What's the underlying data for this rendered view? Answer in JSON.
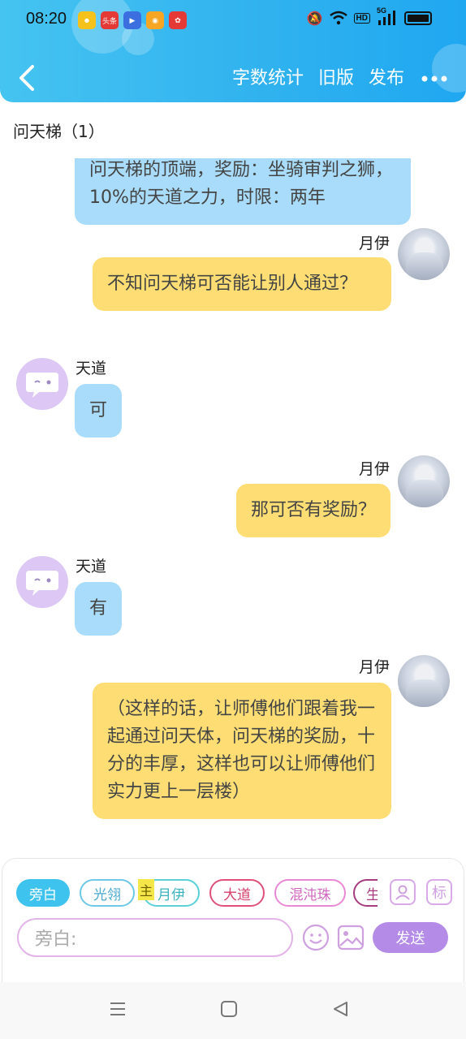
{
  "status_bar": {
    "time": "08:20",
    "notification_icons": [
      {
        "name": "app-icon-yellow",
        "color": "#f4c21a",
        "text": ""
      },
      {
        "name": "toutiao-icon",
        "color": "#e53935",
        "text": "头条"
      },
      {
        "name": "video-app-icon",
        "color": "#3b6fe0",
        "text": ""
      },
      {
        "name": "weibo-icon",
        "color": "#f6a623",
        "text": ""
      },
      {
        "name": "app-icon-red",
        "color": "#e53935",
        "text": ""
      }
    ],
    "signal_label": "5G",
    "hd_label": "HD"
  },
  "header": {
    "back_icon": "chevron-left-icon",
    "actions": [
      "字数统计",
      "旧版",
      "发布"
    ],
    "more_icon": "more-horizontal-icon",
    "accent": "#33b4ef"
  },
  "chat": {
    "title": "问天梯（1）",
    "messages": [
      {
        "side": "left",
        "sender": "",
        "text": "问天梯的顶端，奖励：坐骑审判之狮，10%的天道之力，时限：两年",
        "color": "blue",
        "partial": true
      },
      {
        "side": "right",
        "sender": "月伊",
        "text": "不知问天梯可否能让别人通过？",
        "color": "yellow"
      },
      {
        "side": "left",
        "sender": "天道",
        "text": "可",
        "color": "blue"
      },
      {
        "side": "right",
        "sender": "月伊",
        "text": "那可否有奖励？",
        "color": "yellow"
      },
      {
        "side": "left",
        "sender": "天道",
        "text": "有",
        "color": "blue"
      },
      {
        "side": "right",
        "sender": "月伊",
        "text": "（这样的话，让师傅他们跟着我一起通过问天体，问天梯的奖励，十分的丰厚，这样也可以让师傅他们实力更上一层楼）",
        "color": "yellow"
      }
    ]
  },
  "input_panel": {
    "roles": [
      "旁白",
      "光翎",
      "月伊",
      "大道",
      "混沌珠",
      "生"
    ],
    "main_tag": "主",
    "person_icon": "person-icon",
    "mark_label": "标",
    "input_placeholder": "旁白:",
    "emoji_icon": "emoji-icon",
    "image_icon": "image-icon",
    "send_label": "发送",
    "send_color": "#b58be8"
  },
  "system_nav": {
    "menu_icon": "menu-icon",
    "home_icon": "home-square-icon",
    "back_icon": "back-triangle-icon"
  }
}
